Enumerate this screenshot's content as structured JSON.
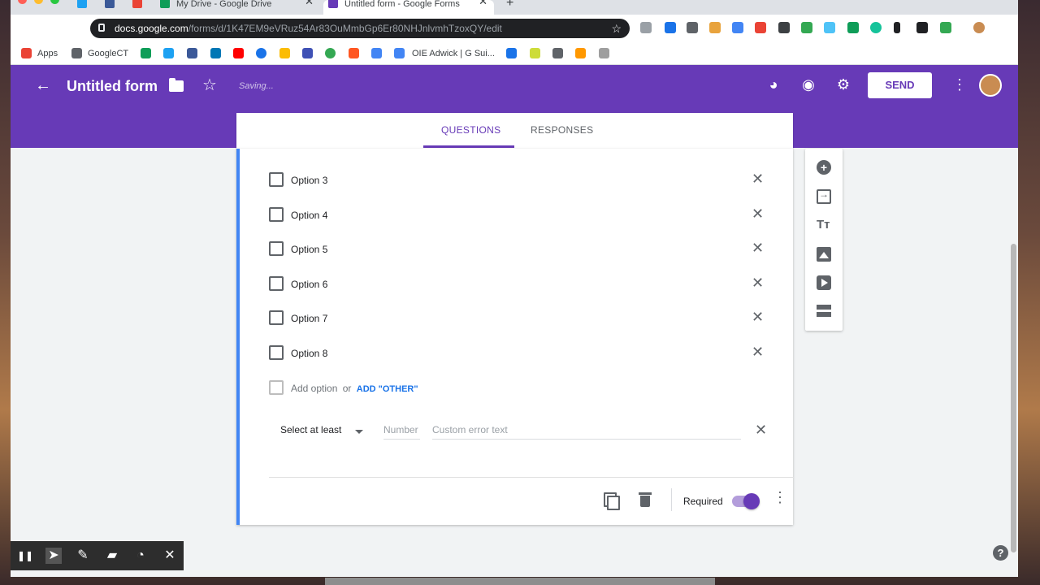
{
  "browser": {
    "tabs": [
      {
        "title": "",
        "icon": "twitter-icon",
        "color": "#1da1f2"
      },
      {
        "title": "",
        "icon": "facebook-icon",
        "color": "#3b5998"
      },
      {
        "title": "",
        "icon": "gmail-icon",
        "color": "#ea4335"
      },
      {
        "title": "My Drive - Google Drive",
        "icon": "drive-icon",
        "color": "#0f9d58"
      },
      {
        "title": "Untitled form - Google Forms",
        "icon": "forms-icon",
        "color": "#673ab7"
      }
    ],
    "close_glyph": "✕",
    "new_tab_glyph": "+",
    "url_host": "docs.google.com",
    "url_path": "/forms/d/1K47EM9eVRuz54Ar83OuMmbGp6Er80NHJnlvmhTzoxQY/edit",
    "bookmarks": [
      {
        "label": "Apps",
        "icon": "apps-icon"
      },
      {
        "label": "GoogleCT",
        "icon": "folder-icon"
      },
      {
        "label": "OIE Adwick | G Sui...",
        "icon": "docs-icon"
      }
    ]
  },
  "form_header": {
    "back_glyph": "←",
    "title": "Untitled form",
    "star_glyph": "☆",
    "status": "Saving...",
    "palette_glyph": "◕",
    "preview_glyph": "◉",
    "settings_glyph": "⚙",
    "send_label": "SEND",
    "more_glyph": "⋮"
  },
  "tabs": {
    "questions": "QUESTIONS",
    "responses": "RESPONSES"
  },
  "question": {
    "options": [
      "Option 3",
      "Option 4",
      "Option 5",
      "Option 6",
      "Option 7",
      "Option 8"
    ],
    "remove_glyph": "✕",
    "add_option": "Add option",
    "or_text": "or",
    "add_other": "ADD \"OTHER\"",
    "validation": {
      "rule": "Select at least",
      "number_placeholder": "Number",
      "error_placeholder": "Custom error text"
    },
    "required_label": "Required",
    "required": true,
    "more_glyph": "⋮"
  },
  "sidebar": {
    "add_glyph": "+",
    "title_glyph": "Tт"
  },
  "help_glyph": "?",
  "recorder": {
    "pause": "❚❚",
    "pointer": "➤",
    "pen": "✎",
    "highlighter": "▰",
    "timer": "◔",
    "close": "✕"
  },
  "colors": {
    "brand": "#673ab7",
    "accent_blue": "#4285f4",
    "link_blue": "#1a73e8"
  }
}
